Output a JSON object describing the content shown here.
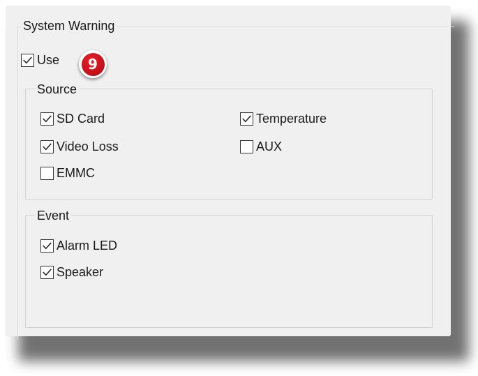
{
  "system_warning": {
    "title": "System Warning",
    "use": {
      "label": "Use",
      "checked": true
    },
    "callout_number": "9"
  },
  "source": {
    "title": "Source",
    "items": [
      {
        "label": "SD Card",
        "checked": true
      },
      {
        "label": "Temperature",
        "checked": true
      },
      {
        "label": "Video Loss",
        "checked": true
      },
      {
        "label": "AUX",
        "checked": false
      },
      {
        "label": "EMMC",
        "checked": false
      }
    ]
  },
  "event": {
    "title": "Event",
    "items": [
      {
        "label": "Alarm LED",
        "checked": true
      },
      {
        "label": "Speaker",
        "checked": true
      }
    ]
  },
  "colors": {
    "panel_bg": "#f0f0f0",
    "callout_red": "#c8101a",
    "text": "#1a1a1a"
  }
}
